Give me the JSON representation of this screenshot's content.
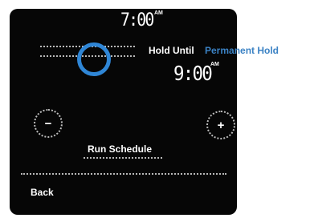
{
  "schedule": {
    "start_time": "7:00",
    "start_ampm": "AM",
    "end_time": "9:00",
    "end_ampm": "AM"
  },
  "hold": {
    "label": "Hold Until",
    "mode": "Permanent Hold"
  },
  "controls": {
    "decrease_symbol": "−",
    "increase_symbol": "+",
    "run_schedule_label": "Run Schedule",
    "back_label": "Back"
  },
  "colors": {
    "accent": "#2f86d6",
    "permanent_hold_text": "#3b82c4",
    "panel_background": "#060606"
  },
  "icons": {
    "slider_handle": "ring-handle-icon"
  }
}
